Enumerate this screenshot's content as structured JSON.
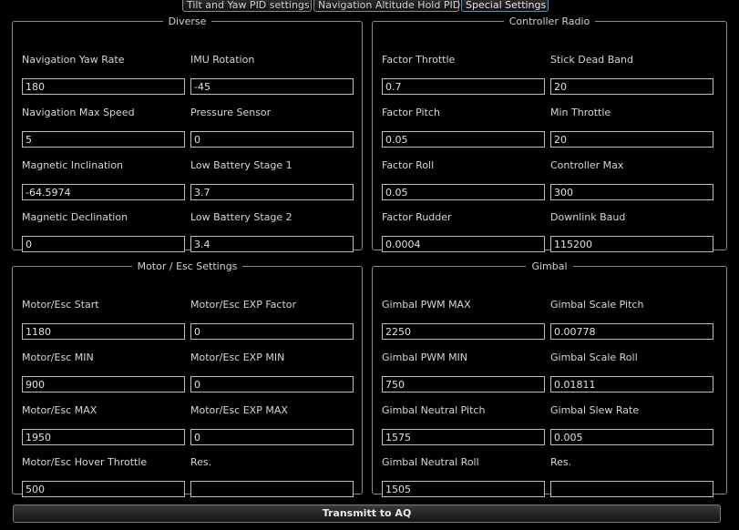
{
  "tabs": [
    "Tilt and Yaw PID settings",
    "Navigation Altitude Hold PID",
    "Special Settings"
  ],
  "groups": {
    "diverse": {
      "title": "Diverse",
      "fields": [
        {
          "label": "Navigation Yaw Rate",
          "value": "180"
        },
        {
          "label": "IMU Rotation",
          "value": "-45"
        },
        {
          "label": "Navigation Max Speed",
          "value": "5"
        },
        {
          "label": "Pressure Sensor",
          "value": "0"
        },
        {
          "label": "Magnetic Inclination",
          "value": "-64.5974"
        },
        {
          "label": "Low Battery Stage 1",
          "value": "3.7"
        },
        {
          "label": "Magnetic Declination",
          "value": "0"
        },
        {
          "label": "Low Battery Stage 2",
          "value": "3.4"
        }
      ]
    },
    "controller_radio": {
      "title": "Controller Radio",
      "fields": [
        {
          "label": "Factor Throttle",
          "value": "0.7"
        },
        {
          "label": "Stick Dead Band",
          "value": "20"
        },
        {
          "label": "Factor Pitch",
          "value": "0.05"
        },
        {
          "label": "Min Throttle",
          "value": "20"
        },
        {
          "label": "Factor Roll",
          "value": "0.05"
        },
        {
          "label": "Controller Max",
          "value": "300"
        },
        {
          "label": "Factor Rudder",
          "value": "0.0004"
        },
        {
          "label": "Downlink Baud",
          "value": "115200"
        }
      ]
    },
    "motor_esc": {
      "title": "Motor / Esc Settings",
      "fields": [
        {
          "label": "Motor/Esc Start",
          "value": "1180"
        },
        {
          "label": "Motor/Esc EXP Factor",
          "value": "0"
        },
        {
          "label": "Motor/Esc MIN",
          "value": "900"
        },
        {
          "label": "Motor/Esc EXP MIN",
          "value": "0"
        },
        {
          "label": "Motor/Esc MAX",
          "value": "1950"
        },
        {
          "label": "Motor/Esc EXP MAX",
          "value": "0"
        },
        {
          "label": "Motor/Esc Hover Throttle",
          "value": "500"
        },
        {
          "label": "Res.",
          "value": ""
        }
      ]
    },
    "gimbal": {
      "title": "Gimbal",
      "fields": [
        {
          "label": "Gimbal PWM MAX",
          "value": "2250"
        },
        {
          "label": "Gimbal Scale Pitch",
          "value": "0.00778"
        },
        {
          "label": "Gimbal PWM MIN",
          "value": "750"
        },
        {
          "label": "Gimbal Scale Roll",
          "value": "0.01811"
        },
        {
          "label": "Gimbal Neutral Pitch",
          "value": "1575"
        },
        {
          "label": "Gimbal Slew Rate",
          "value": "0.005"
        },
        {
          "label": "Gimbal Neutral Roll",
          "value": "1505"
        },
        {
          "label": "Res.",
          "value": ""
        }
      ]
    }
  },
  "transmit_label": "Transmitt to AQ"
}
